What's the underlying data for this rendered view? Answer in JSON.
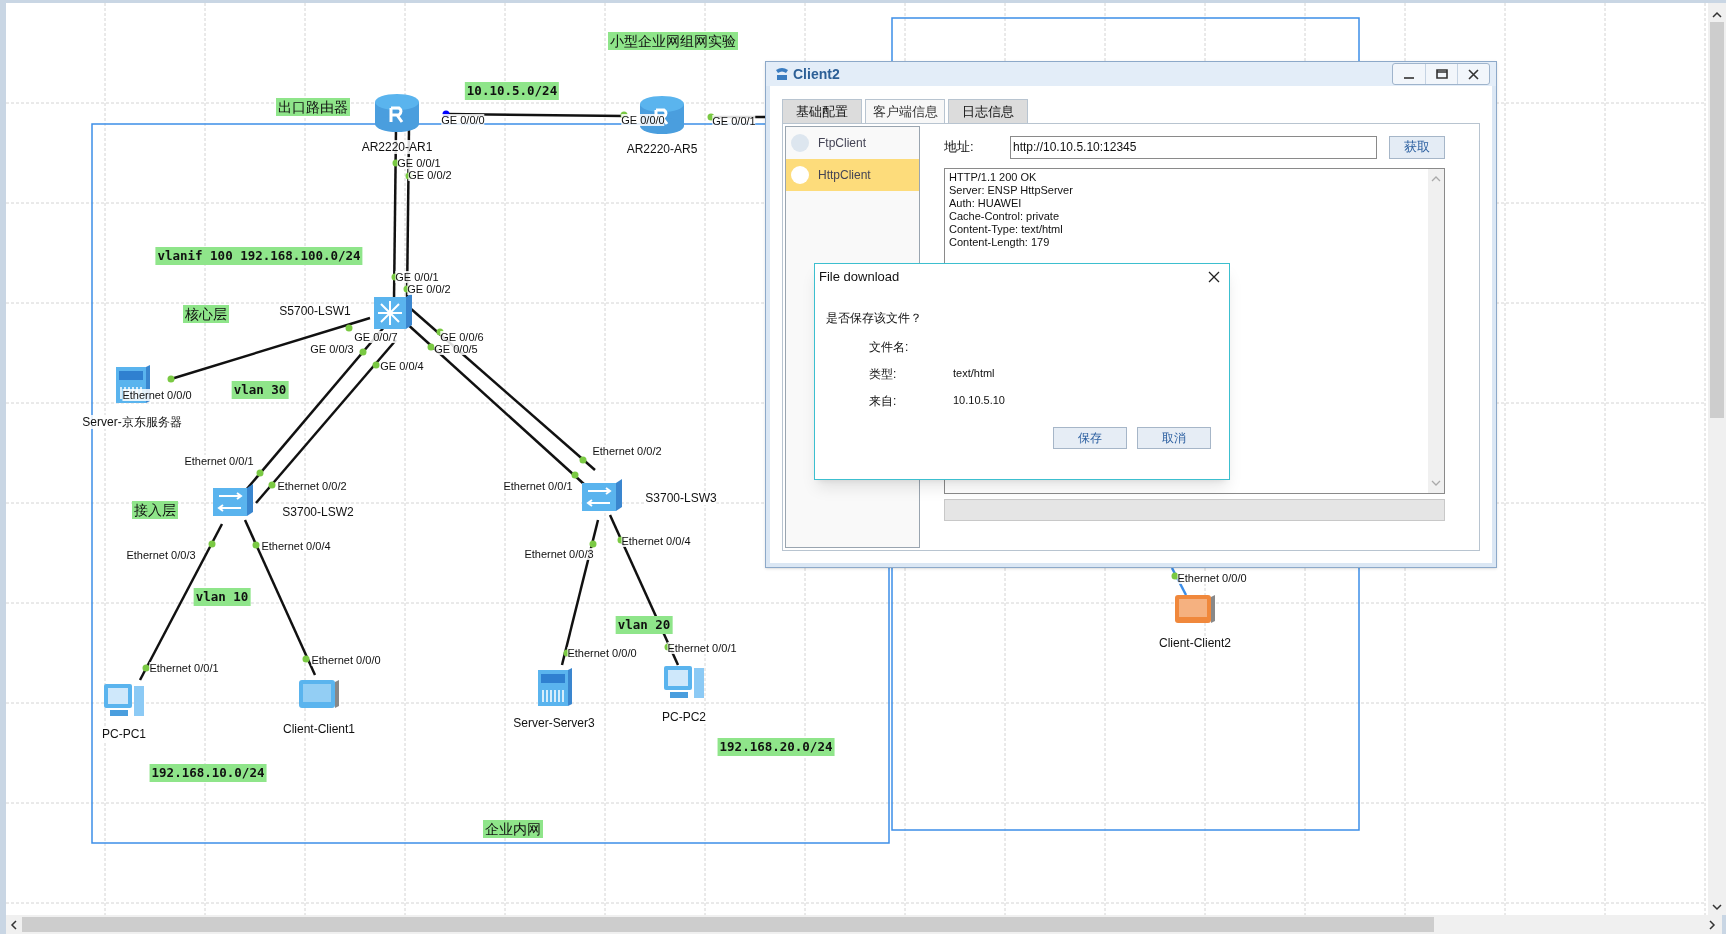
{
  "canvas": {
    "notes": [
      {
        "text": "小型企业网组网实验",
        "kind": "text"
      },
      {
        "text": "出口路由器",
        "kind": "text"
      },
      {
        "text": "10.10.5.0/24",
        "kind": "code"
      },
      {
        "text": "vlanif 100 192.168.100.0/24",
        "kind": "code"
      },
      {
        "text": "核心层",
        "kind": "text"
      },
      {
        "text": "vlan 30",
        "kind": "code"
      },
      {
        "text": "接入层",
        "kind": "text"
      },
      {
        "text": "vlan 10",
        "kind": "code"
      },
      {
        "text": "vlan 20",
        "kind": "code"
      },
      {
        "text": "192.168.10.0/24",
        "kind": "code"
      },
      {
        "text": "192.168.20.0/24",
        "kind": "code"
      },
      {
        "text": "企业内网",
        "kind": "text"
      }
    ],
    "devices": [
      {
        "name": "AR2220-AR1",
        "kind": "router",
        "color": "#5ab4ee"
      },
      {
        "name": "AR2220-AR5",
        "kind": "router",
        "color": "#5ab4ee"
      },
      {
        "name": "S5700-LSW1",
        "kind": "core-switch",
        "color": "#5ab4ee"
      },
      {
        "name": "Server-京东服务器",
        "kind": "server",
        "color": "#5ab4ee"
      },
      {
        "name": "S3700-LSW2",
        "kind": "switch",
        "color": "#5ab4ee"
      },
      {
        "name": "S3700-LSW3",
        "kind": "switch",
        "color": "#5ab4ee"
      },
      {
        "name": "PC-PC1",
        "kind": "pc",
        "color": "#5ab4ee"
      },
      {
        "name": "Client-Client1",
        "kind": "client",
        "color": "#5ab4ee"
      },
      {
        "name": "Server-Server3",
        "kind": "server",
        "color": "#5ab4ee"
      },
      {
        "name": "PC-PC2",
        "kind": "pc",
        "color": "#5ab4ee"
      },
      {
        "name": "Client-Client2",
        "kind": "client",
        "color": "#f0883c"
      }
    ],
    "ports": [
      {
        "text": "GE 0/0/0",
        "color": "#0000ff"
      },
      {
        "text": "GE 0/0/0",
        "color": "#7ac943"
      },
      {
        "text": "GE 0/0/1",
        "color": "#7ac943"
      },
      {
        "text": "GE 0/0/1",
        "color": "#7ac943"
      },
      {
        "text": "GE 0/0/2",
        "color": "#7ac943"
      },
      {
        "text": "GE 0/0/1",
        "color": "#7ac943"
      },
      {
        "text": "GE 0/0/2",
        "color": "#7ac943"
      },
      {
        "text": "GE 0/0/7",
        "color": "#7ac943"
      },
      {
        "text": "GE 0/0/3",
        "color": "#7ac943"
      },
      {
        "text": "GE 0/0/4",
        "color": "#7ac943"
      },
      {
        "text": "GE 0/0/6",
        "color": "#7ac943"
      },
      {
        "text": "GE 0/0/5",
        "color": "#7ac943"
      },
      {
        "text": "Ethernet 0/0/0",
        "color": "#7ac943"
      },
      {
        "text": "Ethernet 0/0/1",
        "color": "#7ac943"
      },
      {
        "text": "Ethernet 0/0/2",
        "color": "#7ac943"
      },
      {
        "text": "Ethernet 0/0/3",
        "color": "#7ac943"
      },
      {
        "text": "Ethernet 0/0/4",
        "color": "#7ac943"
      },
      {
        "text": "Ethernet 0/0/1",
        "color": "#7ac943"
      },
      {
        "text": "Ethernet 0/0/0",
        "color": "#7ac943"
      },
      {
        "text": "Ethernet 0/0/2",
        "color": "#7ac943"
      },
      {
        "text": "Ethernet 0/0/1",
        "color": "#7ac943"
      },
      {
        "text": "Ethernet 0/0/3",
        "color": "#7ac943"
      },
      {
        "text": "Ethernet 0/0/4",
        "color": "#7ac943"
      },
      {
        "text": "Ethernet 0/0/0",
        "color": "#7ac943"
      },
      {
        "text": "Ethernet 0/0/1",
        "color": "#7ac943"
      },
      {
        "text": "Ethernet 0/0/0",
        "color": "#7ac943"
      }
    ]
  },
  "client_window": {
    "title": "Client2",
    "tabs": [
      {
        "label": "基础配置",
        "selected": false
      },
      {
        "label": "客户端信息",
        "selected": true
      },
      {
        "label": "日志信息",
        "selected": false
      }
    ],
    "clients": [
      {
        "label": "FtpClient",
        "selected": false
      },
      {
        "label": "HttpClient",
        "selected": true
      }
    ],
    "address": {
      "label": "地址:",
      "value": "http://10.10.5.10:12345"
    },
    "fetch_button": "获取",
    "response": [
      "HTTP/1.1 200 OK",
      "Server: ENSP HttpServer",
      "Auth: HUAWEI",
      "Cache-Control: private",
      "Content-Type: text/html",
      "Content-Length: 179"
    ],
    "dialog": {
      "title": "File download",
      "question": "是否保存该文件？",
      "fields": [
        {
          "label": "文件名:"
        },
        {
          "label": "类型:",
          "value": "text/html"
        },
        {
          "label": "来自:",
          "value": "10.10.5.10"
        }
      ],
      "buttons": [
        "保存",
        "取消"
      ]
    }
  }
}
